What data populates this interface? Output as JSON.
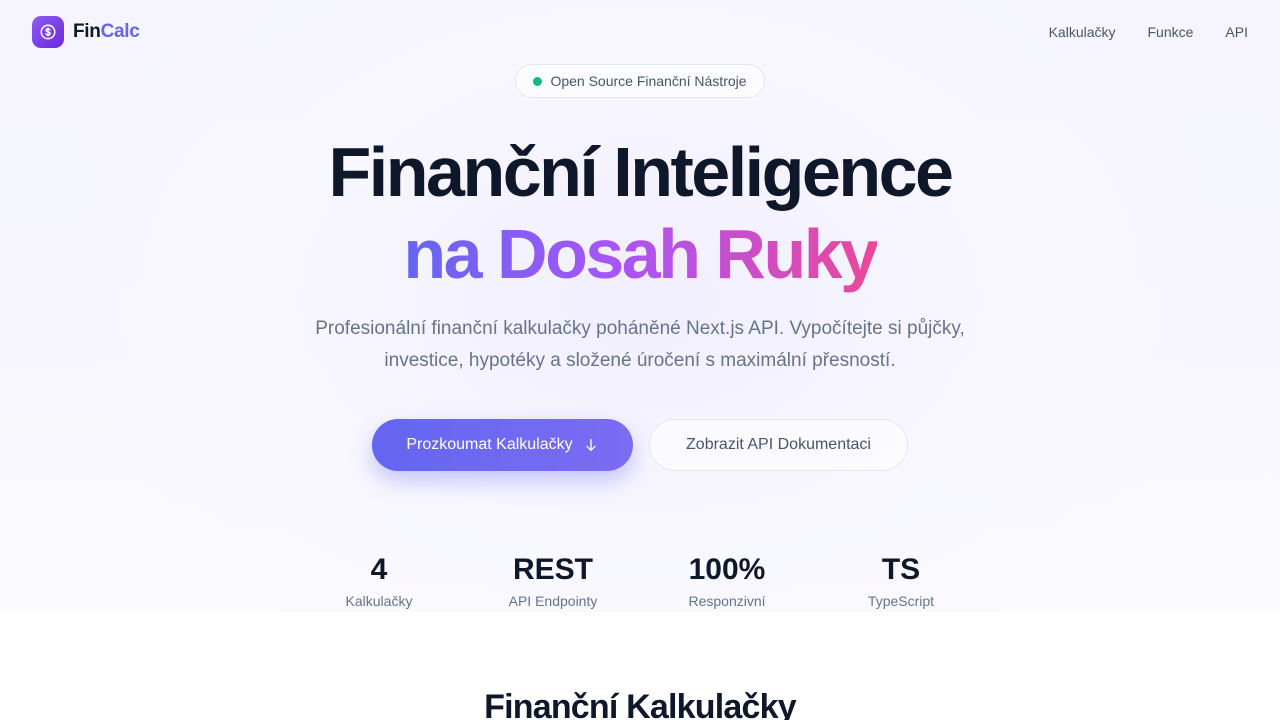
{
  "brand": {
    "name_part1": "Fin",
    "name_part2": "Calc",
    "logo_icon": "dollar-coin-icon",
    "logo_color": "#8b5cf6"
  },
  "nav": {
    "links": [
      {
        "label": "Kalkulačky"
      },
      {
        "label": "Funkce"
      },
      {
        "label": "API"
      }
    ]
  },
  "hero": {
    "badge": "Open Source Finanční Nástroje",
    "badge_dot_color": "#10b981",
    "title_line1": "Finanční Inteligence",
    "title_line2": "na Dosah Ruky",
    "subtitle_line1": "Profesionální finanční kalkulačky poháněné Next.js API. Vypočítejte si půjčky,",
    "subtitle_line2": "investice, hypotéky a složené úročení s maximální přesností.",
    "primary_button": "Prozkoumat Kalkulačky",
    "primary_button_icon": "arrow-down-icon",
    "secondary_button": "Zobrazit API Dokumentaci",
    "accent_color": "#6366f1"
  },
  "stats": [
    {
      "value": "4",
      "label": "Kalkulačky"
    },
    {
      "value": "REST",
      "label": "API Endpointy"
    },
    {
      "value": "100%",
      "label": "Responzivní"
    },
    {
      "value": "TS",
      "label": "TypeScript"
    }
  ],
  "section": {
    "title": "Finanční Kalkulačky"
  }
}
